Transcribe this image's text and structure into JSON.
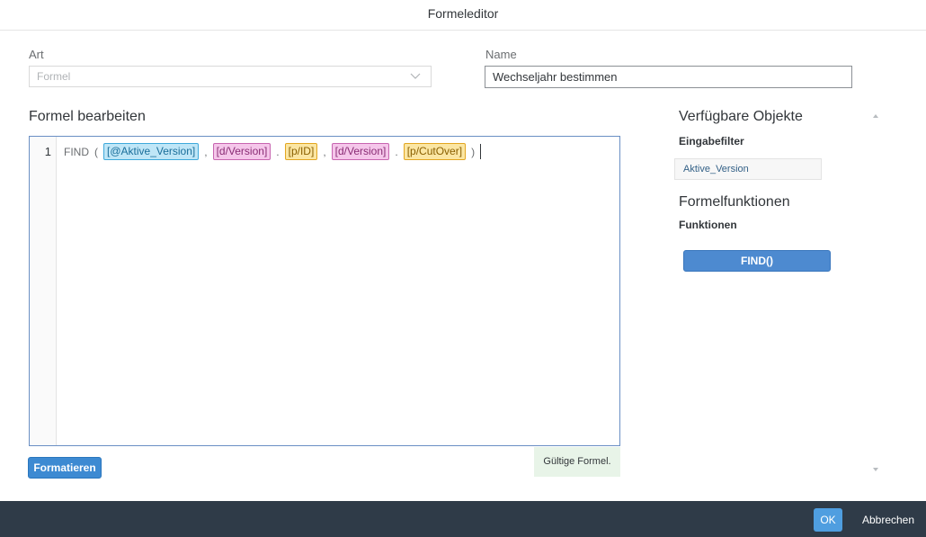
{
  "dialog": {
    "title": "Formeleditor"
  },
  "art": {
    "label": "Art",
    "value": "Formel",
    "icon": "chevron-down-icon"
  },
  "name": {
    "label": "Name",
    "value": "Wechseljahr bestimmen"
  },
  "editor": {
    "title": "Formel bearbeiten",
    "line_number": "1",
    "tokens": {
      "fn": "FIND",
      "open": "(",
      "chip1": "[@Aktive_Version]",
      "comma1": ",",
      "chip2": "[d/Version]",
      "dot1": ".",
      "chip3": "[p/ID]",
      "comma2": ",",
      "chip4": "[d/Version]",
      "dot2": ".",
      "chip5": "[p/CutOver]",
      "close": ")"
    },
    "format_button": "Formatieren",
    "status": "Gültige Formel."
  },
  "sidebar": {
    "objects_title": "Verfügbare Objekte",
    "input_filter_label": "Eingabefilter",
    "input_filter_item": "Aktive_Version",
    "functions_title": "Formelfunktionen",
    "functions_label": "Funktionen",
    "function_button": "FIND()"
  },
  "footer": {
    "ok": "OK",
    "cancel": "Abbrechen"
  },
  "colors": {
    "accent": "#3d8ad2",
    "footer_bg": "#2f3b48",
    "valid_bg": "#e8f4e8"
  }
}
